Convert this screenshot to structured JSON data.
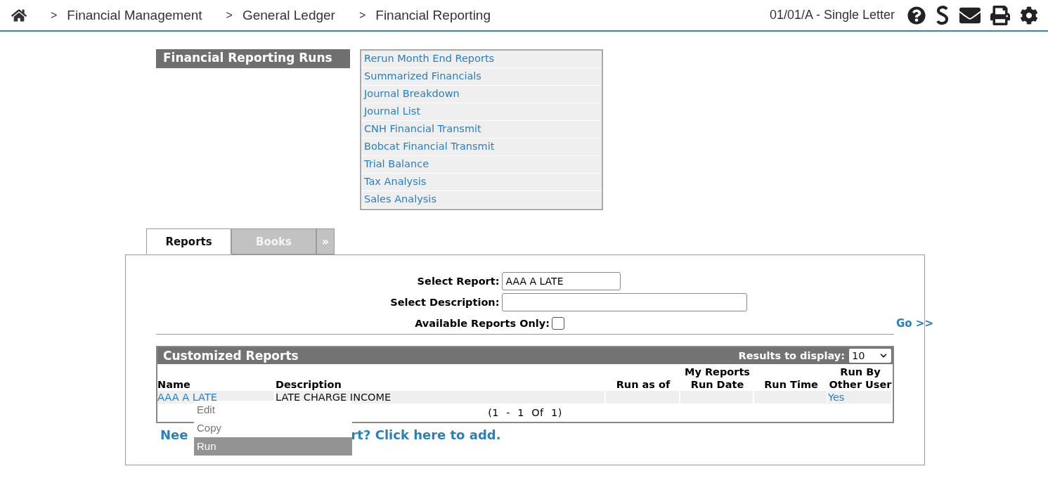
{
  "breadcrumb": {
    "separator": ">",
    "items": [
      "Financial Management",
      "General Ledger",
      "Financial Reporting"
    ]
  },
  "company": "01/01/A - Single Letter",
  "runs": {
    "title": "Financial Reporting Runs",
    "links": [
      "Rerun Month End Reports",
      "Summarized Financials",
      "Journal Breakdown",
      "Journal List",
      "CNH Financial Transmit",
      "Bobcat Financial Transmit",
      "Trial Balance",
      "Tax Analysis",
      "Sales Analysis"
    ]
  },
  "tabs": [
    {
      "label": "Reports",
      "selected": true
    },
    {
      "label": "Books",
      "selected": false
    }
  ],
  "tab_more": "»",
  "filters": {
    "report_label": "Select Report:",
    "report_value": "AAA A LATE",
    "description_label": "Select Description:",
    "available_label": "Available Reports Only:",
    "available_checked": false,
    "go": "Go >>"
  },
  "results": {
    "title": "Customized Reports",
    "display_label": "Results to display:",
    "display_value": "10",
    "columns": [
      [
        "Name"
      ],
      [
        "Description"
      ],
      [
        "Run as of"
      ],
      [
        "My Reports",
        "Run Date"
      ],
      [
        "Run Time"
      ],
      [
        "Run By",
        "Other User"
      ]
    ],
    "rows": [
      {
        "name": "AAA A LATE",
        "description": "LATE CHARGE INCOME",
        "run_by_other_user": "Yes"
      }
    ],
    "pager": "(1  -  1  Of  1)"
  },
  "context_menu": [
    {
      "label": "Edit",
      "selected": false
    },
    {
      "label": "Copy",
      "selected": false
    },
    {
      "label": "Run",
      "selected": true
    }
  ],
  "add_link": [
    "Nee",
    "rt? Click here to add."
  ]
}
